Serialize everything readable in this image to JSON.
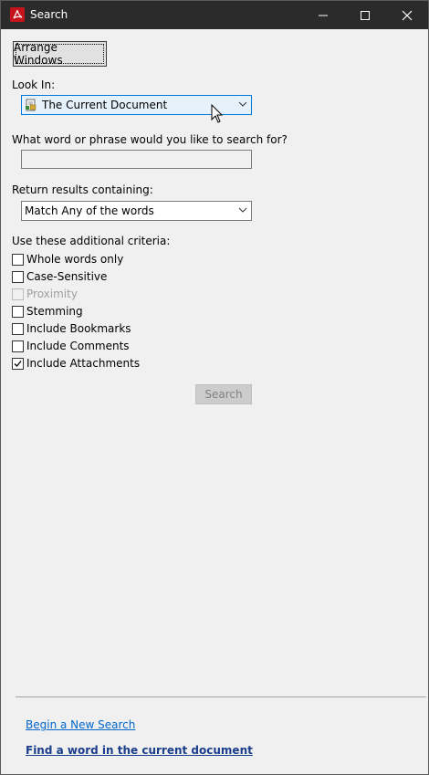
{
  "window": {
    "title": "Search",
    "icon": "adobe-acrobat-icon"
  },
  "arrange_button": "Arrange Windows",
  "look_in": {
    "label": "Look In:",
    "value": "The Current Document",
    "icon": "document-icon"
  },
  "phrase": {
    "label": "What word or phrase would you like to search for?",
    "value": ""
  },
  "results": {
    "label": "Return results containing:",
    "value": "Match Any of the words"
  },
  "criteria": {
    "label": "Use these additional criteria:",
    "options": [
      {
        "label": "Whole words only",
        "checked": false,
        "enabled": true
      },
      {
        "label": "Case-Sensitive",
        "checked": false,
        "enabled": true
      },
      {
        "label": "Proximity",
        "checked": false,
        "enabled": false
      },
      {
        "label": "Stemming",
        "checked": false,
        "enabled": true
      },
      {
        "label": "Include Bookmarks",
        "checked": false,
        "enabled": true
      },
      {
        "label": "Include Comments",
        "checked": false,
        "enabled": true
      },
      {
        "label": "Include Attachments",
        "checked": true,
        "enabled": true
      }
    ]
  },
  "search_button": "Search",
  "links": {
    "new_search": "Begin a New Search",
    "find_word": "Find a word in the current document"
  },
  "colors": {
    "titlebar": "#2b2b2b",
    "link": "#0066cc",
    "accent": "#0078d7"
  }
}
